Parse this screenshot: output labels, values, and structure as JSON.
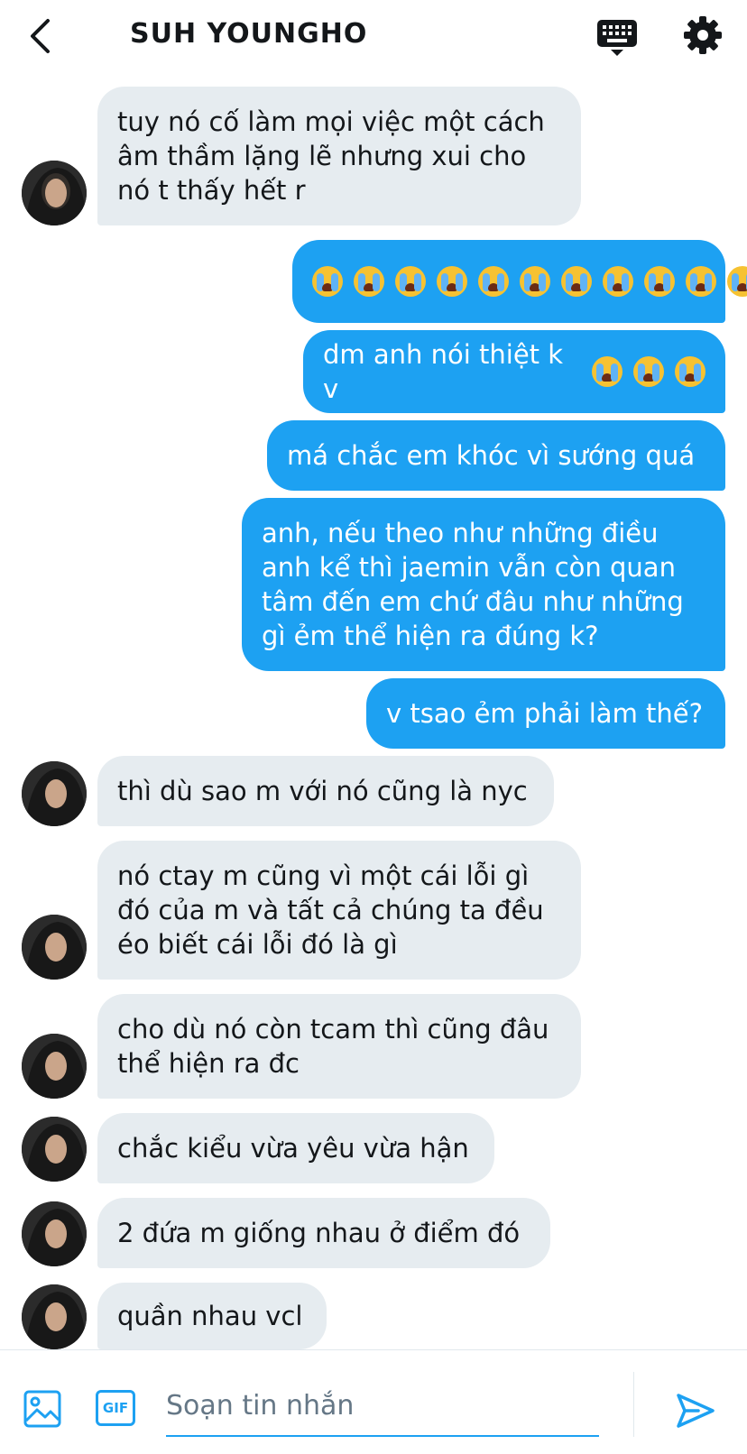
{
  "header": {
    "title": "SUH YOUNGHO",
    "back_icon": "chevron-left-icon",
    "keyboard_icon": "keyboard-icon",
    "settings_icon": "gear-icon"
  },
  "messages": [
    {
      "side": "in",
      "text": "tuy nó cố làm mọi việc một cách âm thầm lặng lẽ nhưng xui cho nó t thấy hết r"
    },
    {
      "side": "out",
      "emoji_count": 11,
      "emoji": "loudly-crying-face"
    },
    {
      "side": "out",
      "text": "dm anh nói thiệt k v",
      "emoji_count": 3,
      "emoji": "loudly-crying-face"
    },
    {
      "side": "out",
      "text": "má chắc em khóc vì sướng quá"
    },
    {
      "side": "out",
      "text": "anh, nếu theo như những điều anh kể thì jaemin vẫn còn quan tâm đến em chứ đâu như những gì ẻm thể hiện ra đúng k?"
    },
    {
      "side": "out",
      "text": "v tsao ẻm phải làm thế?"
    },
    {
      "side": "in",
      "text": "thì dù sao m với nó cũng là nyc"
    },
    {
      "side": "in",
      "text": "nó ctay m cũng vì một cái lỗi gì đó của m và tất cả chúng ta đều éo biết cái lỗi đó là gì"
    },
    {
      "side": "in",
      "text": "cho dù nó còn tcam thì cũng đâu thể hiện ra đc"
    },
    {
      "side": "in",
      "text": "chắc kiểu vừa yêu vừa hận"
    },
    {
      "side": "in",
      "text": "2 đứa m giống nhau ở điểm đó"
    },
    {
      "side": "in",
      "text": "quần nhau vcl"
    }
  ],
  "composer": {
    "placeholder": "Soạn tin nhắn",
    "gif_label": "GIF",
    "image_icon": "image-icon",
    "send_icon": "send-icon"
  },
  "colors": {
    "accent": "#1da1f2",
    "incoming_bubble": "#e6ecf0",
    "text": "#14171a"
  }
}
